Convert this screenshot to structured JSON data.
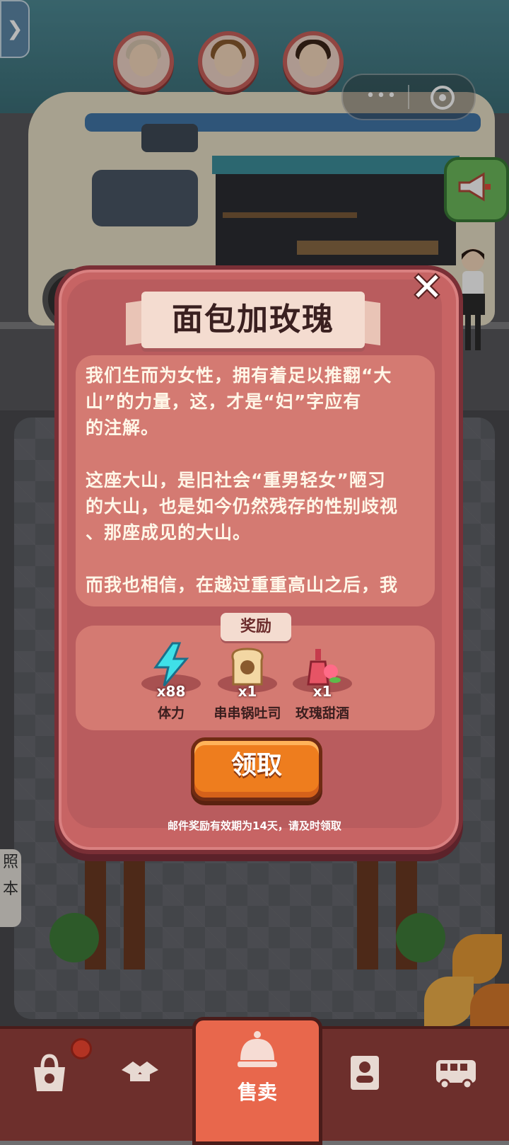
{
  "game": {
    "side_labels": [
      "照",
      "本"
    ]
  },
  "capsule": {
    "dots": "•••"
  },
  "avatars": [
    {
      "name": "avatar-grandma",
      "hair": "#d9c6b0"
    },
    {
      "name": "avatar-boy",
      "hair": "#8a5a2e"
    },
    {
      "name": "avatar-girl",
      "hair": "#3b2418"
    }
  ],
  "modal": {
    "title": "面包加玫瑰",
    "story_paragraphs": [
      [
        "我们生而为女性，拥有着足以推翻“大",
        "山”的力量，这，才是“妇”字应有",
        "的注解。"
      ],
      [
        "这座大山，是旧社会“重男轻女”陋习",
        "的大山，也是如今仍然残存的性别歧视",
        "、那座成见的大山。"
      ],
      [
        "而我也相信，在越过重重高山之后，我"
      ]
    ],
    "reward_header": "奖励",
    "rewards": [
      {
        "qty": "x88",
        "name": "体力",
        "icon": "lightning-icon"
      },
      {
        "qty": "x1",
        "name": "串串锅吐司",
        "icon": "toast-icon"
      },
      {
        "qty": "x1",
        "name": "玫瑰甜酒",
        "icon": "rose-wine-icon"
      }
    ],
    "claim_label": "领取",
    "notice": "邮件奖励有效期为14天，请及时领取",
    "close_glyph": "✕"
  },
  "nav": {
    "items": [
      {
        "icon": "shop-bag-icon"
      },
      {
        "icon": "handshake-icon"
      },
      {
        "label": "售卖",
        "icon": "service-bell-icon"
      },
      {
        "icon": "staff-icon"
      },
      {
        "icon": "bus-icon"
      }
    ]
  },
  "colors": {
    "modal_bg": "#c76464",
    "panel": "#d47a72",
    "accent_button": "#ee7d1e",
    "nav_bg": "#6d2f2c",
    "nav_active": "#e8674c"
  }
}
